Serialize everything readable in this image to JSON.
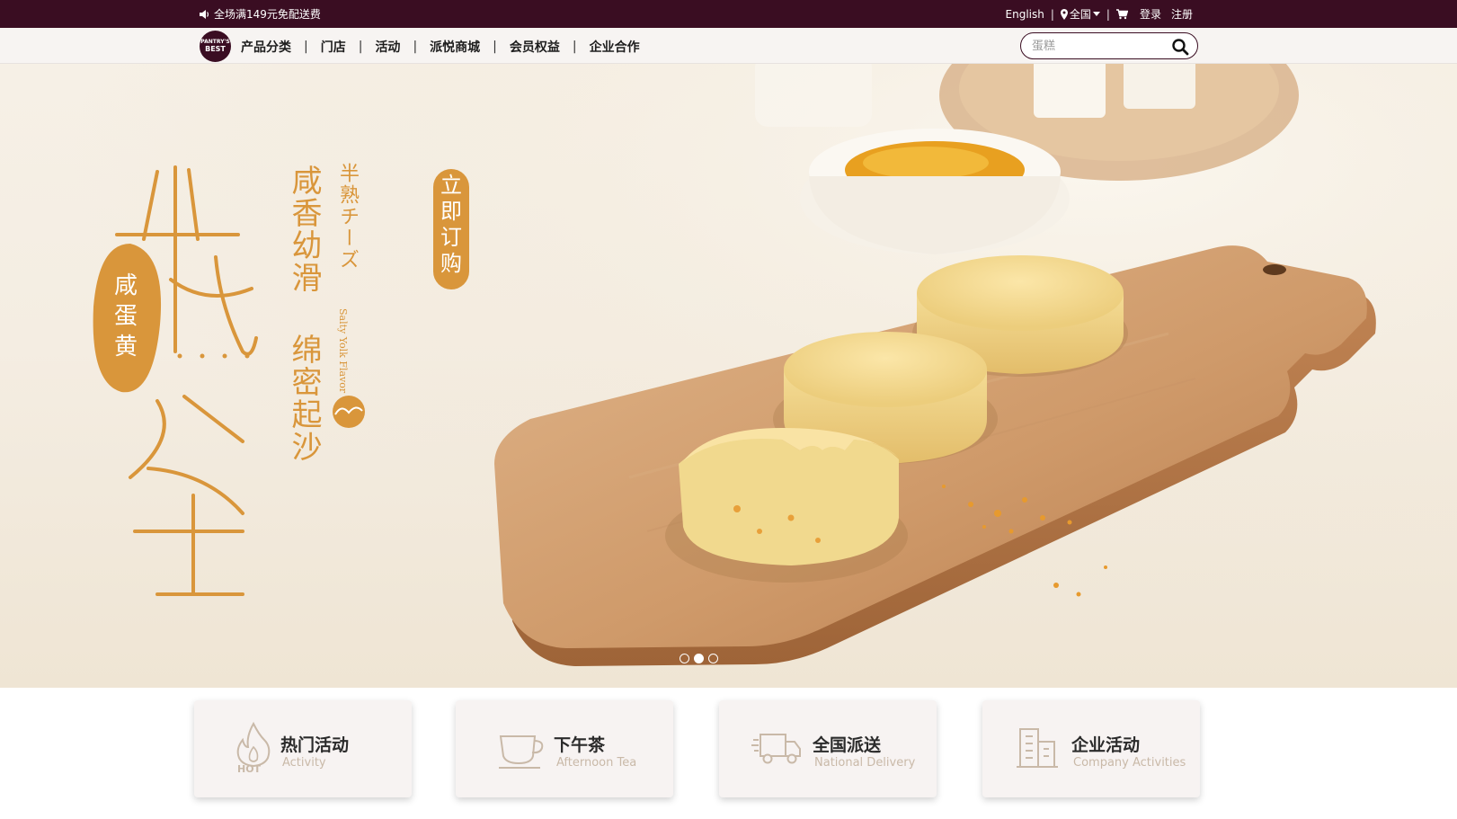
{
  "topbar": {
    "notice": "全场满149元免配送费",
    "language": "English",
    "region": "全国",
    "login": "登录",
    "register": "注册",
    "separator": "|"
  },
  "nav": {
    "logo_text_line1": "PANTRY'S",
    "logo_text_line2": "BEST",
    "items": [
      {
        "label": "产品分类"
      },
      {
        "label": "门店"
      },
      {
        "label": "活动"
      },
      {
        "label": "派悦商城"
      },
      {
        "label": "会员权益"
      },
      {
        "label": "企业合作"
      }
    ],
    "separator": "|",
    "search": {
      "placeholder": "蛋糕",
      "value": ""
    }
  },
  "hero": {
    "title_big": [
      "半",
      "熟",
      "芝",
      "士"
    ],
    "badge": [
      "咸",
      "蛋",
      "黄"
    ],
    "subtitle_jp": "半熟チーズ",
    "subtitle_en": "Salty Yolk Flavor",
    "tagline_col1": "咸香幼滑",
    "tagline_col2": "绵密起沙",
    "cta": [
      "立",
      "即",
      "订",
      "购"
    ],
    "slides": 3,
    "active_slide": 2
  },
  "features": [
    {
      "title": "热门活动",
      "subtitle": "Activity",
      "icon": "hot-flame-icon",
      "icon_text": "HOT"
    },
    {
      "title": "下午茶",
      "subtitle": "Afternoon Tea",
      "icon": "teacup-icon"
    },
    {
      "title": "全国派送",
      "subtitle": "National Delivery",
      "icon": "delivery-truck-icon"
    },
    {
      "title": "企业活动",
      "subtitle": "Company Activities",
      "icon": "building-icon"
    }
  ],
  "colors": {
    "brand": "#3a0d22",
    "accent": "#d9963b",
    "card_bg": "#f7f3f2",
    "subtitle": "#c9b9a8"
  }
}
